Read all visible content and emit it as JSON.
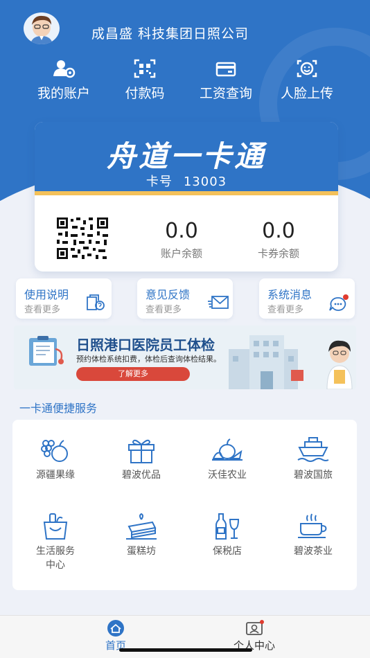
{
  "header": {
    "company": "成昌盛  科技集团日照公司"
  },
  "quick_actions": [
    {
      "label": "我的账户",
      "icon": "account-icon"
    },
    {
      "label": "付款码",
      "icon": "qr-scan-icon"
    },
    {
      "label": "工资查询",
      "icon": "wallet-icon"
    },
    {
      "label": "人脸上传",
      "icon": "face-icon"
    }
  ],
  "card": {
    "title": "舟道一卡通",
    "number_label": "卡号",
    "number": "13003",
    "account_balance": "0.0",
    "account_balance_label": "账户余额",
    "coupon_balance": "0.0",
    "coupon_balance_label": "卡券余额"
  },
  "info_cards": [
    {
      "title": "使用说明",
      "sub": "查看更多",
      "icon": "manual-icon"
    },
    {
      "title": "意见反馈",
      "sub": "查看更多",
      "icon": "mail-icon"
    },
    {
      "title": "系统消息",
      "sub": "查看更多",
      "icon": "message-icon"
    }
  ],
  "banner": {
    "title": "日照港口医院员工体检",
    "subtitle": "预约体检系统扣费，体检后查询体检结果。",
    "button": "了解更多"
  },
  "services": {
    "title": "一卡通便捷服务",
    "items": [
      {
        "label": "源疆果缘",
        "icon": "fruit-icon"
      },
      {
        "label": "碧波优品",
        "icon": "gift-icon"
      },
      {
        "label": "沃佳农业",
        "icon": "vegetable-icon"
      },
      {
        "label": "碧波国旅",
        "icon": "ship-icon"
      },
      {
        "label": "生活服务\n中心",
        "icon": "shopping-basket-icon"
      },
      {
        "label": "蛋糕坊",
        "icon": "cake-icon"
      },
      {
        "label": "保税店",
        "icon": "wine-icon"
      },
      {
        "label": "碧波茶业",
        "icon": "tea-icon"
      }
    ]
  },
  "tabbar": [
    {
      "label": "首页",
      "icon": "home-icon",
      "active": true
    },
    {
      "label": "个人中心",
      "icon": "profile-icon",
      "active": false
    }
  ],
  "colors": {
    "primary": "#2f74c6",
    "accent": "#f4c15a",
    "badge": "#e03b2f"
  }
}
